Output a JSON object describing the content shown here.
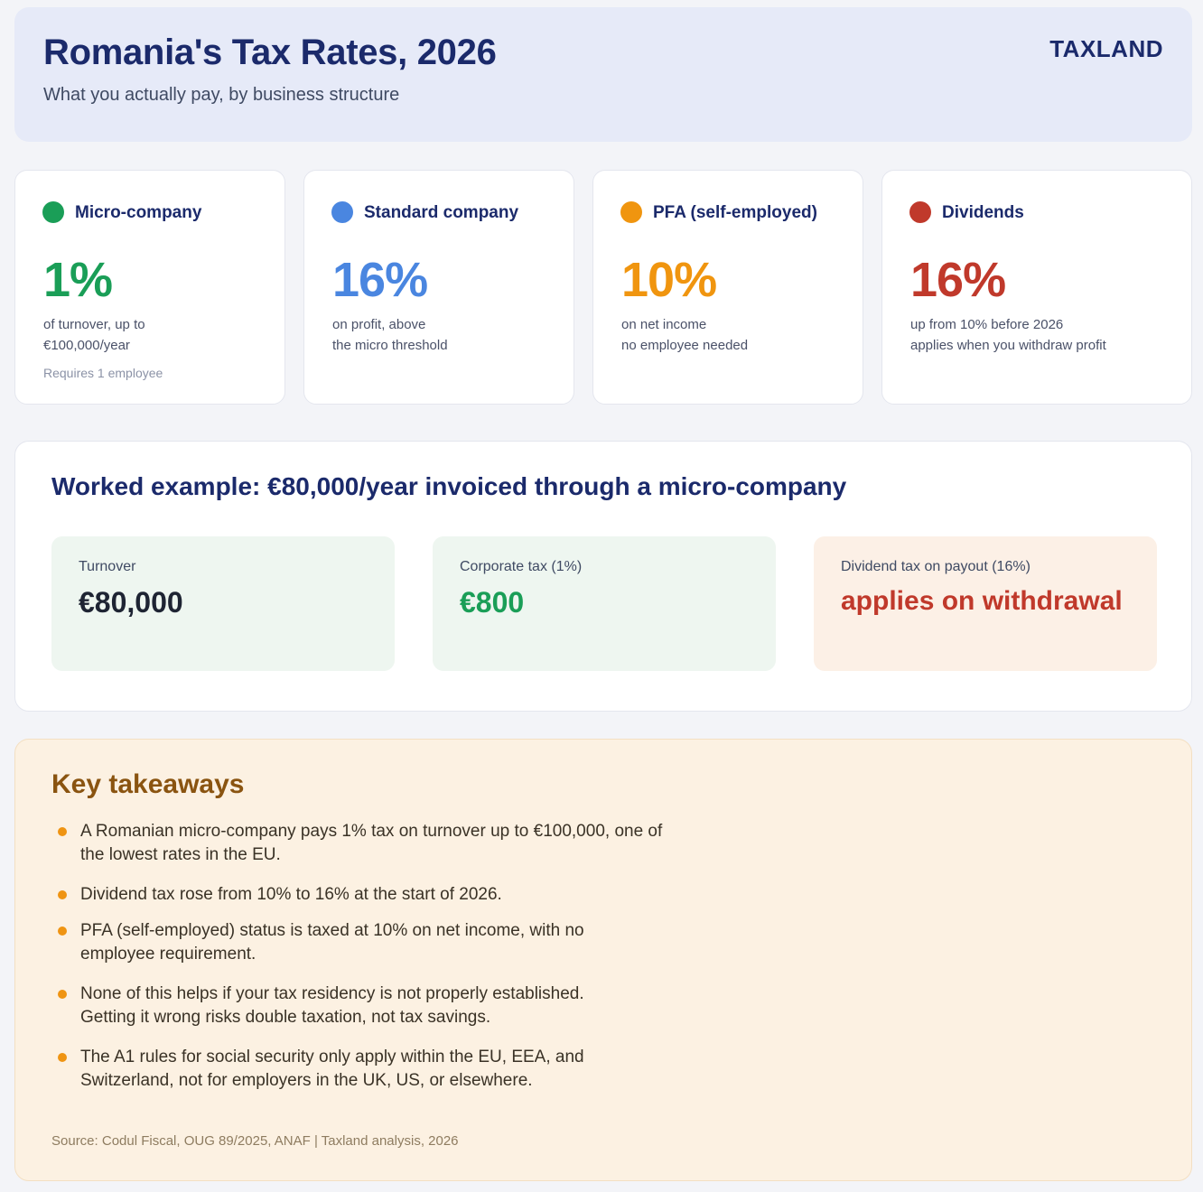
{
  "header": {
    "title": "Romania's Tax Rates, 2026",
    "subtitle": "What you actually pay, by business structure",
    "brand": "TAXLAND"
  },
  "colors": {
    "green": "#1a9e57",
    "blue": "#4a86e0",
    "orange": "#f0950f",
    "red": "#c0392b",
    "navy": "#1b2a6b"
  },
  "cards": [
    {
      "name": "Micro-company",
      "rate": "1%",
      "desc_line1": "of turnover, up to",
      "desc_line2": "€100,000/year",
      "note": "Requires 1 employee"
    },
    {
      "name": "Standard company",
      "rate": "16%",
      "desc_line1": "on profit, above",
      "desc_line2": "the micro threshold"
    },
    {
      "name": "PFA (self-employed)",
      "rate": "10%",
      "desc_line1": "on net income",
      "desc_line2": "no employee needed"
    },
    {
      "name": "Dividends",
      "rate": "16%",
      "desc_line1": "up from 10% before 2026",
      "desc_line2": "applies when you withdraw profit"
    }
  ],
  "example": {
    "title": "Worked example: €80,000/year invoiced through a micro-company",
    "boxes": [
      {
        "label": "Turnover",
        "value": "€80,000"
      },
      {
        "label": "Corporate tax (1%)",
        "value": "€800"
      },
      {
        "label": "Dividend tax on payout (16%)",
        "value": "applies on withdrawal"
      }
    ]
  },
  "takeaways": {
    "title": "Key takeaways",
    "items": [
      {
        "line1": "A Romanian micro-company pays 1% tax on turnover up to €100,000, one of",
        "line2": "the lowest rates in the EU."
      },
      {
        "line1": "Dividend tax rose from 10% to 16% at the start of 2026.",
        "line2": ""
      },
      {
        "line1": "PFA (self-employed) status is taxed at 10% on net income, with no",
        "line2": "employee requirement."
      },
      {
        "line1": "None of this helps if your tax residency is not properly established.",
        "line2": "Getting it wrong risks double taxation, not tax savings."
      },
      {
        "line1": "The A1 rules for social security only apply within the EU, EEA, and",
        "line2": "Switzerland, not for employers in the UK, US, or elsewhere."
      }
    ],
    "source": "Source: Codul Fiscal, OUG 89/2025, ANAF | Taxland analysis, 2026"
  }
}
